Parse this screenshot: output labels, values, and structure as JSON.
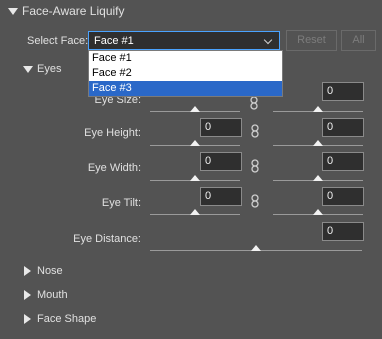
{
  "panel": {
    "title": "Face-Aware Liquify"
  },
  "face_select": {
    "label": "Select Face:",
    "value": "Face #1",
    "options": [
      "Face #1",
      "Face #2",
      "Face #3"
    ],
    "highlighted": "Face #3",
    "reset_label": "Reset",
    "all_label": "All"
  },
  "eyes": {
    "title": "Eyes",
    "size": {
      "label": "Eye Size:",
      "left": "",
      "right": "0",
      "left_level": 0.5,
      "right_level": 0.5
    },
    "height": {
      "label": "Eye Height:",
      "left": "0",
      "right": "0",
      "left_level": 0.5,
      "right_level": 0.5
    },
    "width": {
      "label": "Eye Width:",
      "left": "0",
      "right": "0",
      "left_level": 0.5,
      "right_level": 0.5
    },
    "tilt": {
      "label": "Eye Tilt:",
      "left": "0",
      "right": "0",
      "left_level": 0.5,
      "right_level": 0.5
    },
    "distance": {
      "label": "Eye Distance:",
      "value": "0",
      "level": 0.5
    }
  },
  "sections": {
    "nose": "Nose",
    "mouth": "Mouth",
    "face_shape": "Face Shape"
  },
  "colors": {
    "panel_bg": "#535353",
    "accent": "#4aa3ff",
    "highlight": "#2a68c8"
  }
}
